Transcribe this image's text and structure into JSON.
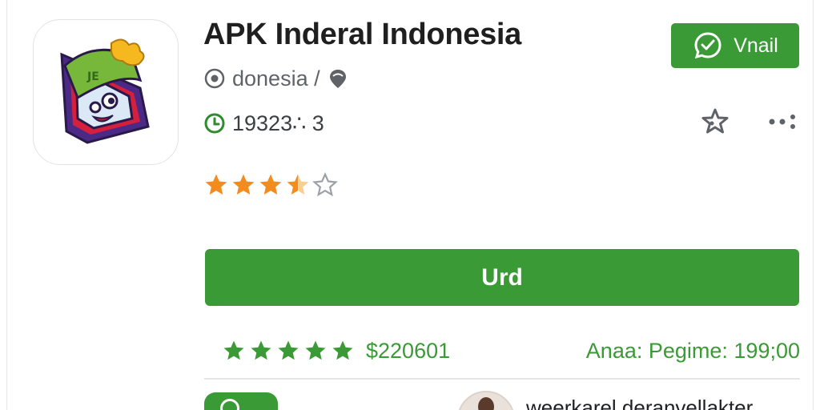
{
  "app": {
    "title": "APK Inderal Indonesia",
    "publisher": "donesia /",
    "downloads": "19323∴ 3",
    "rating_stars": 3.5
  },
  "buttons": {
    "top_label": "Vnail",
    "main_label": "Urd"
  },
  "stats": {
    "stars": 5,
    "count": "$220601",
    "right_text": "Anaa: Pegime: 199;00"
  },
  "bottom": {
    "text": "weerkarel deranvellakter"
  },
  "colors": {
    "accent_green": "#3a9a35",
    "star_orange": "#f48c1d",
    "text_gray": "#5f6368"
  },
  "icons": {
    "app": "app-logo-icon",
    "publisher": "location-pin-icon",
    "downloads": "clock-icon",
    "top_button": "whatsapp-icon",
    "wishlist": "star-outline-icon",
    "more": "more-dots-icon"
  }
}
